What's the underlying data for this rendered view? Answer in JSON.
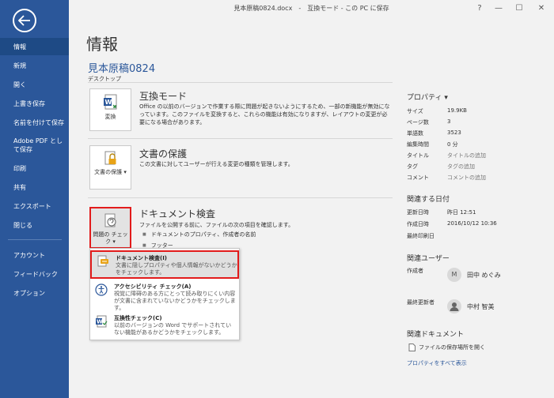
{
  "window": {
    "title": "見本原稿0824.docx　-　互換モード - この PC に保存",
    "controls": {
      "help": "?",
      "minimize": "—",
      "maximize": "☐",
      "close": "✕"
    }
  },
  "sidebar": {
    "items": [
      {
        "label": "情報",
        "active": true
      },
      {
        "label": "新規"
      },
      {
        "label": "開く"
      },
      {
        "label": "上書き保存"
      },
      {
        "label": "名前を付けて保存"
      },
      {
        "label": "Adobe PDF として保存"
      },
      {
        "label": "印刷"
      },
      {
        "label": "共有"
      },
      {
        "label": "エクスポート"
      },
      {
        "label": "閉じる"
      },
      {
        "label": "アカウント"
      },
      {
        "label": "フィードバック"
      },
      {
        "label": "オプション"
      }
    ]
  },
  "main": {
    "page_title": "情報",
    "doc_name": "見本原稿0824",
    "doc_location": "デスクトップ",
    "compat": {
      "tile_label": "変換",
      "title": "互換モード",
      "desc": "Office の以前のバージョンで作業する際に問題が起きないようにするため、一部の新機能が無効になっています。このファイルを変換すると、これらの機能は有効になりますが、レイアウトの変更が必要になる場合があります。"
    },
    "protect": {
      "tile_label": "文書の保護 ▾",
      "title": "文書の保護",
      "desc": "この文書に対してユーザーが行える変更の種類を管理します。"
    },
    "inspect": {
      "tile_label": "問題の チェック ▾",
      "title": "ドキュメント検査",
      "desc": "ファイルを公開する前に、ファイルの次の項目を確認します。",
      "bullets": [
        "ドキュメントのプロパティ、作成者の名前",
        "フッター"
      ]
    }
  },
  "dropdown": {
    "items": [
      {
        "head": "ドキュメント検査(I)",
        "body": "文書に隠しプロパティや個人情報がないかどうかをチェックします。"
      },
      {
        "head": "アクセシビリティ チェック(A)",
        "body": "視覚に障碍のある方にとって読み取りにくい内容が文書に含まれていないかどうかをチェックします。"
      },
      {
        "head": "互換性チェック(C)",
        "body": "以前のバージョンの Word でサポートされていない機能があるかどうかをチェックします。"
      }
    ]
  },
  "properties": {
    "header": "プロパティ ▾",
    "rows": [
      {
        "label": "サイズ",
        "value": "19.9KB"
      },
      {
        "label": "ページ数",
        "value": "3"
      },
      {
        "label": "単語数",
        "value": "3523"
      },
      {
        "label": "編集時間",
        "value": "0 分"
      },
      {
        "label": "タイトル",
        "value": "タイトルの追加"
      },
      {
        "label": "タグ",
        "value": "タグの追加"
      },
      {
        "label": "コメント",
        "value": "コメントの追加"
      }
    ]
  },
  "dates": {
    "header": "関連する日付",
    "rows": [
      {
        "label": "更新日時",
        "value": "昨日 12:51"
      },
      {
        "label": "作成日時",
        "value": "2016/10/12 10:36"
      },
      {
        "label": "最終印刷日",
        "value": ""
      }
    ]
  },
  "people": {
    "header": "関連ユーザー",
    "author_label": "作成者",
    "author_initial": "M",
    "author_name": "田中 めぐみ",
    "modifier_label": "最終更新者",
    "modifier_name": "中村 智美"
  },
  "related_docs": {
    "header": "関連ドキュメント",
    "open_location": "ファイルの保存場所を開く",
    "show_all": "プロパティをすべて表示"
  },
  "colors": {
    "accent": "#2b579a",
    "highlight_border": "#e21b1b"
  }
}
